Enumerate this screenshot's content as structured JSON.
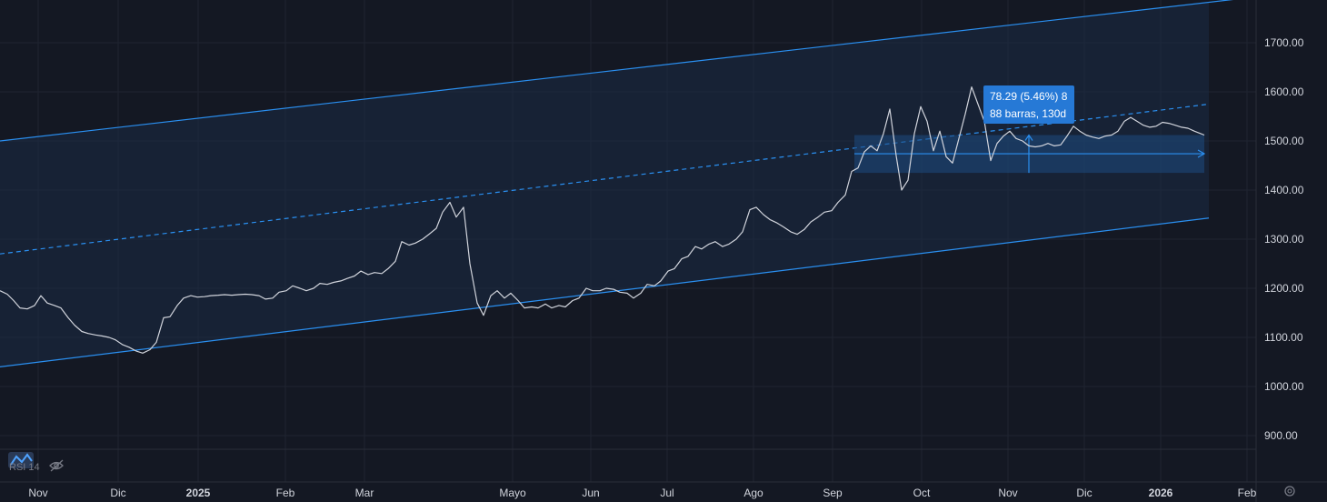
{
  "colors": {
    "background": "#141823",
    "grid": "#1f2430",
    "price_line": "#d1d4dc",
    "channel": "#2a8ff0",
    "channel_fill": "#1a2b45",
    "measure_fill": "#1d4a80",
    "tooltip_bg": "#2679d6"
  },
  "chart_data": {
    "type": "line",
    "price_axis": {
      "labels": [
        "1700.00",
        "1600.00",
        "1500.00",
        "1400.00",
        "1300.00",
        "1200.00",
        "1100.00",
        "1000.00",
        "900.00"
      ],
      "ylim": [
        860,
        1780
      ]
    },
    "time_axis": {
      "labels": [
        {
          "text": "Nov"
        },
        {
          "text": "Dic"
        },
        {
          "text": "2025",
          "year": true
        },
        {
          "text": "Feb"
        },
        {
          "text": "Mar"
        },
        {
          "text": "Mayo"
        },
        {
          "text": "Jun"
        },
        {
          "text": "Jul"
        },
        {
          "text": "Ago"
        },
        {
          "text": "Sep"
        },
        {
          "text": "Oct"
        },
        {
          "text": "Nov"
        },
        {
          "text": "Dic"
        },
        {
          "text": "2026",
          "year": true
        },
        {
          "text": "Feb"
        }
      ]
    },
    "series": [
      {
        "values": [
          [
            0,
            1195
          ],
          [
            8,
            1188
          ],
          [
            15,
            1175
          ],
          [
            22,
            1160
          ],
          [
            30,
            1158
          ],
          [
            38,
            1165
          ],
          [
            45,
            1185
          ],
          [
            52,
            1170
          ],
          [
            60,
            1165
          ],
          [
            67,
            1160
          ],
          [
            75,
            1140
          ],
          [
            82,
            1125
          ],
          [
            90,
            1112
          ],
          [
            97,
            1108
          ],
          [
            105,
            1105
          ],
          [
            112,
            1103
          ],
          [
            120,
            1100
          ],
          [
            127,
            1095
          ],
          [
            135,
            1085
          ],
          [
            142,
            1080
          ],
          [
            150,
            1072
          ],
          [
            157,
            1068
          ],
          [
            165,
            1075
          ],
          [
            172,
            1090
          ],
          [
            180,
            1140
          ],
          [
            187,
            1142
          ],
          [
            195,
            1165
          ],
          [
            202,
            1180
          ],
          [
            210,
            1185
          ],
          [
            217,
            1182
          ],
          [
            225,
            1183
          ],
          [
            232,
            1185
          ],
          [
            240,
            1186
          ],
          [
            247,
            1187
          ],
          [
            255,
            1186
          ],
          [
            262,
            1187
          ],
          [
            270,
            1188
          ],
          [
            277,
            1187
          ],
          [
            285,
            1185
          ],
          [
            292,
            1178
          ],
          [
            300,
            1180
          ],
          [
            307,
            1192
          ],
          [
            315,
            1195
          ],
          [
            322,
            1205
          ],
          [
            330,
            1200
          ],
          [
            337,
            1195
          ],
          [
            345,
            1200
          ],
          [
            352,
            1210
          ],
          [
            360,
            1208
          ],
          [
            367,
            1212
          ],
          [
            375,
            1215
          ],
          [
            382,
            1220
          ],
          [
            390,
            1225
          ],
          [
            397,
            1235
          ],
          [
            405,
            1228
          ],
          [
            412,
            1232
          ],
          [
            420,
            1230
          ],
          [
            427,
            1240
          ],
          [
            435,
            1255
          ],
          [
            442,
            1295
          ],
          [
            450,
            1288
          ],
          [
            457,
            1292
          ],
          [
            465,
            1300
          ],
          [
            472,
            1310
          ],
          [
            480,
            1322
          ],
          [
            487,
            1355
          ],
          [
            495,
            1375
          ],
          [
            502,
            1345
          ],
          [
            510,
            1365
          ],
          [
            517,
            1250
          ],
          [
            525,
            1170
          ],
          [
            532,
            1145
          ],
          [
            540,
            1185
          ],
          [
            547,
            1195
          ],
          [
            555,
            1180
          ],
          [
            562,
            1190
          ],
          [
            570,
            1175
          ],
          [
            577,
            1160
          ],
          [
            585,
            1162
          ],
          [
            592,
            1160
          ],
          [
            600,
            1168
          ],
          [
            607,
            1160
          ],
          [
            615,
            1165
          ],
          [
            622,
            1162
          ],
          [
            630,
            1175
          ],
          [
            637,
            1180
          ],
          [
            645,
            1200
          ],
          [
            652,
            1195
          ],
          [
            660,
            1195
          ],
          [
            667,
            1200
          ],
          [
            675,
            1198
          ],
          [
            682,
            1192
          ],
          [
            690,
            1190
          ],
          [
            697,
            1180
          ],
          [
            705,
            1190
          ],
          [
            712,
            1208
          ],
          [
            720,
            1205
          ],
          [
            727,
            1215
          ],
          [
            735,
            1235
          ],
          [
            742,
            1240
          ],
          [
            750,
            1260
          ],
          [
            757,
            1265
          ],
          [
            765,
            1285
          ],
          [
            772,
            1280
          ],
          [
            780,
            1290
          ],
          [
            787,
            1295
          ],
          [
            795,
            1285
          ],
          [
            802,
            1290
          ],
          [
            810,
            1300
          ],
          [
            817,
            1315
          ],
          [
            825,
            1360
          ],
          [
            832,
            1365
          ],
          [
            840,
            1350
          ],
          [
            847,
            1340
          ],
          [
            855,
            1333
          ],
          [
            862,
            1325
          ],
          [
            870,
            1315
          ],
          [
            877,
            1310
          ],
          [
            885,
            1320
          ],
          [
            892,
            1335
          ],
          [
            900,
            1345
          ],
          [
            907,
            1355
          ],
          [
            915,
            1358
          ],
          [
            922,
            1375
          ],
          [
            930,
            1390
          ],
          [
            937,
            1438
          ],
          [
            944,
            1445
          ],
          [
            951,
            1478
          ],
          [
            958,
            1490
          ],
          [
            965,
            1480
          ],
          [
            972,
            1515
          ],
          [
            979,
            1565
          ],
          [
            986,
            1470
          ],
          [
            992,
            1400
          ],
          [
            999,
            1420
          ],
          [
            1006,
            1515
          ],
          [
            1013,
            1570
          ],
          [
            1020,
            1540
          ],
          [
            1027,
            1480
          ],
          [
            1034,
            1520
          ],
          [
            1041,
            1468
          ],
          [
            1048,
            1455
          ],
          [
            1055,
            1505
          ],
          [
            1062,
            1555
          ],
          [
            1069,
            1610
          ],
          [
            1076,
            1575
          ],
          [
            1083,
            1540
          ],
          [
            1090,
            1460
          ],
          [
            1097,
            1495
          ],
          [
            1104,
            1510
          ],
          [
            1111,
            1520
          ],
          [
            1118,
            1505
          ],
          [
            1125,
            1500
          ],
          [
            1132,
            1490
          ],
          [
            1139,
            1488
          ],
          [
            1146,
            1490
          ],
          [
            1153,
            1495
          ],
          [
            1160,
            1490
          ],
          [
            1167,
            1492
          ],
          [
            1174,
            1510
          ],
          [
            1181,
            1530
          ],
          [
            1188,
            1520
          ],
          [
            1195,
            1512
          ],
          [
            1202,
            1508
          ],
          [
            1209,
            1505
          ],
          [
            1216,
            1510
          ],
          [
            1223,
            1512
          ],
          [
            1230,
            1520
          ],
          [
            1237,
            1540
          ],
          [
            1244,
            1548
          ],
          [
            1251,
            1540
          ],
          [
            1258,
            1532
          ],
          [
            1265,
            1528
          ],
          [
            1272,
            1530
          ],
          [
            1279,
            1538
          ],
          [
            1286,
            1536
          ],
          [
            1293,
            1532
          ],
          [
            1300,
            1528
          ],
          [
            1307,
            1526
          ],
          [
            1314,
            1520
          ],
          [
            1321,
            1515
          ],
          [
            1325,
            1512
          ]
        ]
      }
    ],
    "channel": {
      "upper": [
        [
          0,
          1500
        ],
        [
          1460,
          1810
        ]
      ],
      "middle": [
        [
          0,
          1270
        ],
        [
          1330,
          1575
        ]
      ],
      "lower": [
        [
          0,
          1040
        ],
        [
          1330,
          1343
        ]
      ]
    },
    "measure": {
      "x_start": 940,
      "x_end": 1325,
      "y_top": 1512,
      "y_bottom": 1435,
      "y_mid": 1474,
      "tooltip_line1": "78.29 (5.46%) 8",
      "tooltip_line2": "88 barras, 130d"
    },
    "indicator_label": "RSI 14"
  }
}
